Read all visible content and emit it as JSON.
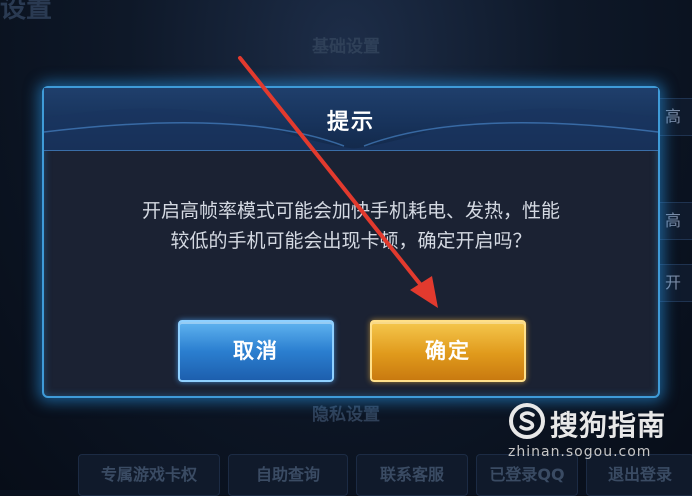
{
  "background": {
    "title": "设置",
    "section_basic": "基础设置",
    "section_privacy": "隐私设置",
    "side_labels": [
      "高",
      "高",
      "开"
    ],
    "bottom_buttons": [
      "专属游戏卡权",
      "自助查询",
      "联系客服",
      "已登录QQ",
      "退出登录"
    ]
  },
  "dialog": {
    "title": "提示",
    "message_line1": "开启高帧率模式可能会加快手机耗电、发热，性能",
    "message_line2": "较低的手机可能会出现卡顿，确定开启吗？",
    "cancel_label": "取消",
    "confirm_label": "确定"
  },
  "watermark": {
    "brand": "搜狗指南",
    "url": "zhinan.sogou.com"
  },
  "colors": {
    "accent_blue": "#3f9bd8",
    "confirm_gold": "#e09a1c",
    "annotation_red": "#e23a2e"
  }
}
